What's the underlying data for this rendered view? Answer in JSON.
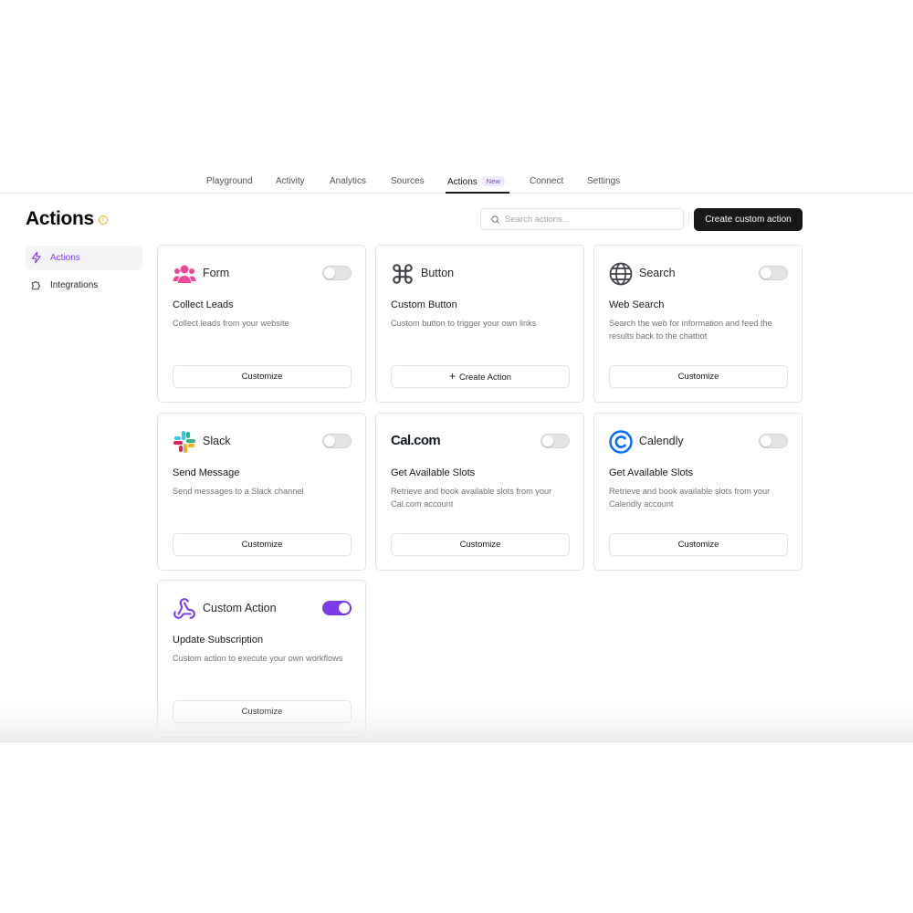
{
  "nav": {
    "tabs": [
      {
        "label": "Playground"
      },
      {
        "label": "Activity"
      },
      {
        "label": "Analytics"
      },
      {
        "label": "Sources"
      },
      {
        "label": "Actions",
        "badge": "New",
        "active": true
      },
      {
        "label": "Connect"
      },
      {
        "label": "Settings"
      }
    ]
  },
  "page": {
    "title": "Actions"
  },
  "search": {
    "placeholder": "Search actions..."
  },
  "create_button": "Create custom action",
  "sidebar": {
    "items": [
      {
        "label": "Actions",
        "icon": "lightning-icon",
        "active": true
      },
      {
        "label": "Integrations",
        "icon": "puzzle-icon",
        "active": false
      }
    ]
  },
  "cards": [
    {
      "name": "Form",
      "icon": "users-icon",
      "enabled": false,
      "title": "Collect Leads",
      "desc": "Collect leads from your website",
      "button": "Customize"
    },
    {
      "name": "Button",
      "icon": "command-icon",
      "enabled": false,
      "title": "Custom Button",
      "desc": "Custom button to trigger your own links",
      "button": "Create Action"
    },
    {
      "name": "Search",
      "icon": "globe-icon",
      "enabled": false,
      "title": "Web Search",
      "desc": "Search the web for information and feed the results back to the chatbot",
      "button": "Customize"
    },
    {
      "name": "Slack",
      "icon": "slack-icon",
      "enabled": false,
      "title": "Send Message",
      "desc": "Send messages to a Slack channel",
      "button": "Customize"
    },
    {
      "name": "Cal.com",
      "icon": "calcom-logo",
      "enabled": false,
      "title": "Get Available Slots",
      "desc": "Retrieve and book available slots from your Cal.com account",
      "button": "Customize"
    },
    {
      "name": "Calendly",
      "icon": "calendly-icon",
      "enabled": false,
      "title": "Get Available Slots",
      "desc": "Retrieve and book available slots from your Calendly account",
      "button": "Customize"
    },
    {
      "name": "Custom Action",
      "icon": "webhook-icon",
      "enabled": true,
      "title": "Update Subscription",
      "desc": "Custom action to execute your own workflows",
      "button": "Customize"
    }
  ],
  "colors": {
    "accent": "#7c3aed",
    "dark": "#18181b",
    "form": "#ec4899",
    "calendly": "#006bff",
    "info": "#eab308"
  }
}
